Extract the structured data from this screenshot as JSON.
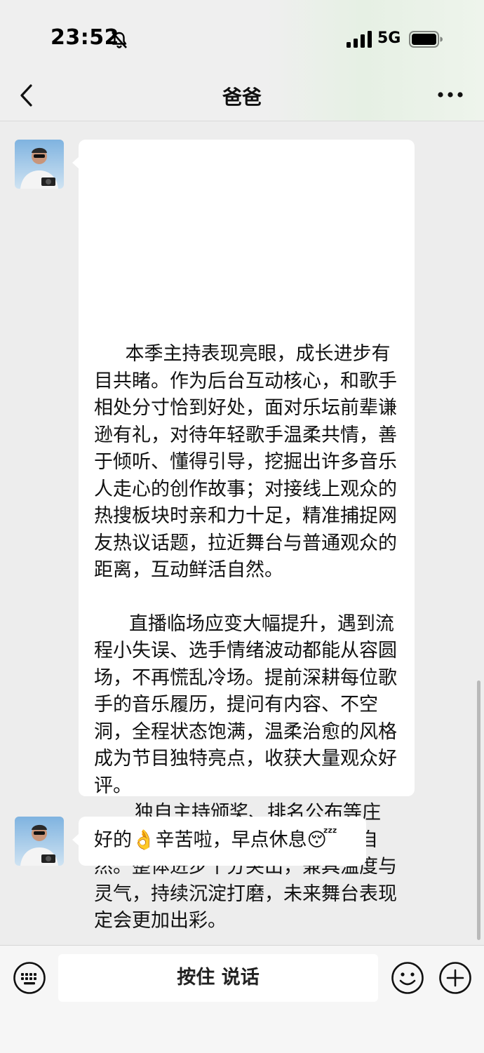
{
  "status_bar": {
    "time": "23:52",
    "network": "5G",
    "icons": [
      "bell-slash-icon",
      "signal-bars-icon",
      "battery-icon"
    ]
  },
  "nav": {
    "title": "爸爸",
    "back_icon": "chevron-left-icon",
    "more_icon": "more-dots-icon"
  },
  "messages": [
    {
      "sender": "contact",
      "paragraphs": [
        "本季主持表现亮眼，成长进步有目共睹。作为后台互动核心，和歌手相处分寸恰到好处，面对乐坛前辈谦逊有礼，对待年轻歌手温柔共情，善于倾听、懂得引导，挖掘出许多音乐人走心的创作故事；对接线上观众的热搜板块时亲和力十足，精准捕捉网友热议话题，拉近舞台与普通观众的距离，互动鲜活自然。",
        "直播临场应变大幅提升，遇到流程小失误、选手情绪波动都能从容圆场，不再慌乱冷场。提前深耕每位歌手的音乐履历，提问有内容、不空洞，全程状态饱满，温柔治愈的风格成为节目独特亮点，收获大量观众好评。",
        "独自主持颁奖、排名公布等庄重环节气场稳定，访谈内容深度自然。整体进步十分突出，兼具温度与灵气，持续沉淀打磨，未来舞台表现定会更加出彩。"
      ]
    },
    {
      "sender": "contact",
      "text_a": "好的",
      "emoji_a": "👌",
      "text_b": "辛苦啦，早点休息",
      "emoji_b": "😴"
    }
  ],
  "input_bar": {
    "voice_label": "按住 说话",
    "keyboard_icon": "keyboard-icon",
    "emoji_icon": "smiley-icon",
    "plus_icon": "plus-circle-icon"
  },
  "colors": {
    "background": "#ededed",
    "bubble": "#ffffff",
    "header_tint": "#e6f0e4"
  }
}
